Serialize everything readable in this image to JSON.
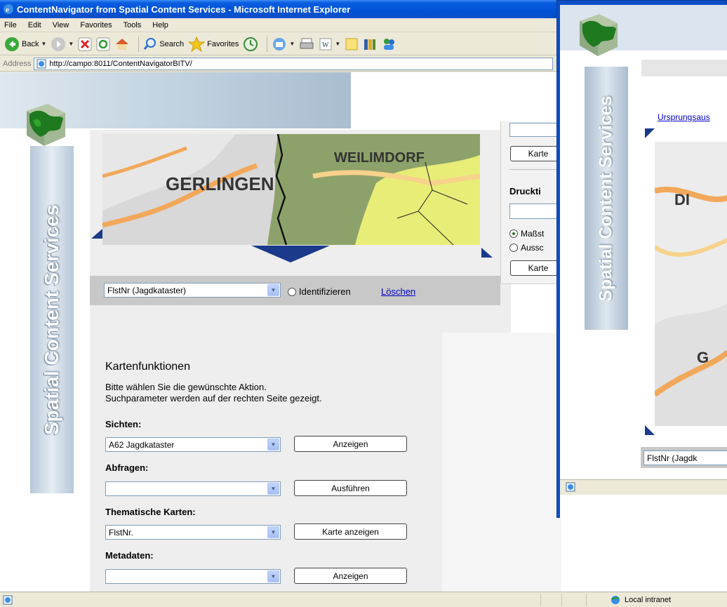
{
  "window": {
    "title": "ContentNavigator from Spatial Content Services - Microsoft Internet Explorer"
  },
  "menu": [
    "File",
    "Edit",
    "View",
    "Favorites",
    "Tools",
    "Help"
  ],
  "toolbar": {
    "back": "Back",
    "search": "Search",
    "favorites": "Favorites"
  },
  "address": {
    "label": "Address",
    "url": "http://campo:8011/ContentNavigatorBITV/"
  },
  "banner": {
    "text": "Spatial Content Services"
  },
  "map": {
    "labels": [
      "GERLINGEN",
      "WEILIMDORF"
    ]
  },
  "print": {
    "button1": "Karte",
    "title_label": "Druckti",
    "radio1": "Maßst",
    "radio2": "Aussc",
    "button2": "Karte"
  },
  "search": {
    "select_value": "FlstNr (Jagdkataster)",
    "identify_label": "Identifizieren",
    "clear_link": "Löschen"
  },
  "functions": {
    "title": "Kartenfunktionen",
    "desc_line1": "Bitte wählen Sie die gewünschte Aktion.",
    "desc_line2": "Suchparameter werden auf der rechten Seite gezeigt.",
    "views_label": "Sichten:",
    "views_value": "A62 Jagdkataster",
    "views_button": "Anzeigen",
    "queries_label": "Abfragen:",
    "queries_value": "",
    "queries_button": "Ausführen",
    "thematic_label": "Thematische Karten:",
    "thematic_value": "FlstNr.",
    "thematic_button": "Karte anzeigen",
    "metadata_label": "Metadaten:",
    "metadata_value": "",
    "metadata_button": "Anzeigen"
  },
  "status": {
    "zone": "Local intranet"
  },
  "second_window": {
    "link": "Ursprungsaus",
    "banner_text": "Spatial Content Services",
    "map_labels": [
      "DI",
      "G"
    ],
    "select_value": "FlstNr (Jagdk"
  },
  "colors": {
    "titlebar": "#0a5ee0",
    "link": "#0000cc",
    "map_green": "#6d9a3a",
    "map_yellow": "#eef07a"
  }
}
